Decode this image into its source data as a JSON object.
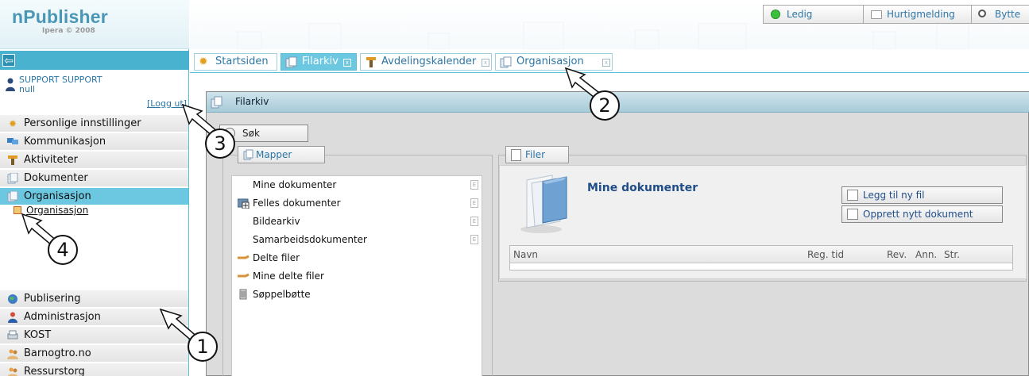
{
  "app": {
    "name": "nPublisher",
    "copyright": "Ipera © 2008"
  },
  "top_buttons": [
    {
      "label": "Ledig"
    },
    {
      "label": "Hurtigmelding"
    },
    {
      "label": "Bytte"
    }
  ],
  "tabs": [
    {
      "label": "Startsiden",
      "closable": false,
      "active": false
    },
    {
      "label": "Filarkiv",
      "closable": true,
      "active": true
    },
    {
      "label": "Avdelingskalender",
      "closable": true,
      "active": false
    },
    {
      "label": "Organisasjon",
      "closable": true,
      "active": false
    }
  ],
  "user": {
    "name": "SUPPORT SUPPORT",
    "sub": "null",
    "logout": "[Logg ut]"
  },
  "nav": {
    "items": [
      {
        "label": "Personlige innstillinger",
        "icon": "gear-icon"
      },
      {
        "label": "Kommunikasjon",
        "icon": "communication-icon"
      },
      {
        "label": "Aktiviteter",
        "icon": "activities-icon"
      },
      {
        "label": "Dokumenter",
        "icon": "documents-icon"
      },
      {
        "label": "Organisasjon",
        "icon": "organisation-icon",
        "active": true
      }
    ],
    "subitem": {
      "label": "Organisasjon"
    },
    "bottom_items": [
      {
        "label": "Publisering",
        "icon": "globe-icon"
      },
      {
        "label": "Administrasjon",
        "icon": "admin-user-icon"
      },
      {
        "label": "KOST",
        "icon": "printer-icon"
      },
      {
        "label": "Barnogtro.no",
        "icon": "people-icon"
      },
      {
        "label": "Ressurstorg",
        "icon": "people-icon"
      }
    ]
  },
  "panel": {
    "title": "Filarkiv",
    "search_label": "Søk",
    "mapper": {
      "legend": "Mapper",
      "items": [
        {
          "label": "Mine dokumenter",
          "icon": "none"
        },
        {
          "label": "Felles dokumenter",
          "icon": "expand-folder-icon"
        },
        {
          "label": "Bildearkiv",
          "icon": "none"
        },
        {
          "label": "Samarbeidsdokumenter",
          "icon": "none"
        },
        {
          "label": "Delte filer",
          "icon": "shared-icon"
        },
        {
          "label": "Mine delte filer",
          "icon": "shared-icon"
        },
        {
          "label": "Søppelbøtte",
          "icon": "trash-icon"
        }
      ]
    },
    "filer": {
      "legend": "Filer",
      "title": "Mine dokumenter",
      "add_file": "Legg til ny fil",
      "create_doc": "Opprett nytt dokument",
      "columns": [
        "Navn",
        "Reg. tid",
        "Rev.",
        "Ann.",
        "Str."
      ]
    }
  },
  "callouts": [
    "1",
    "2",
    "3",
    "4"
  ]
}
